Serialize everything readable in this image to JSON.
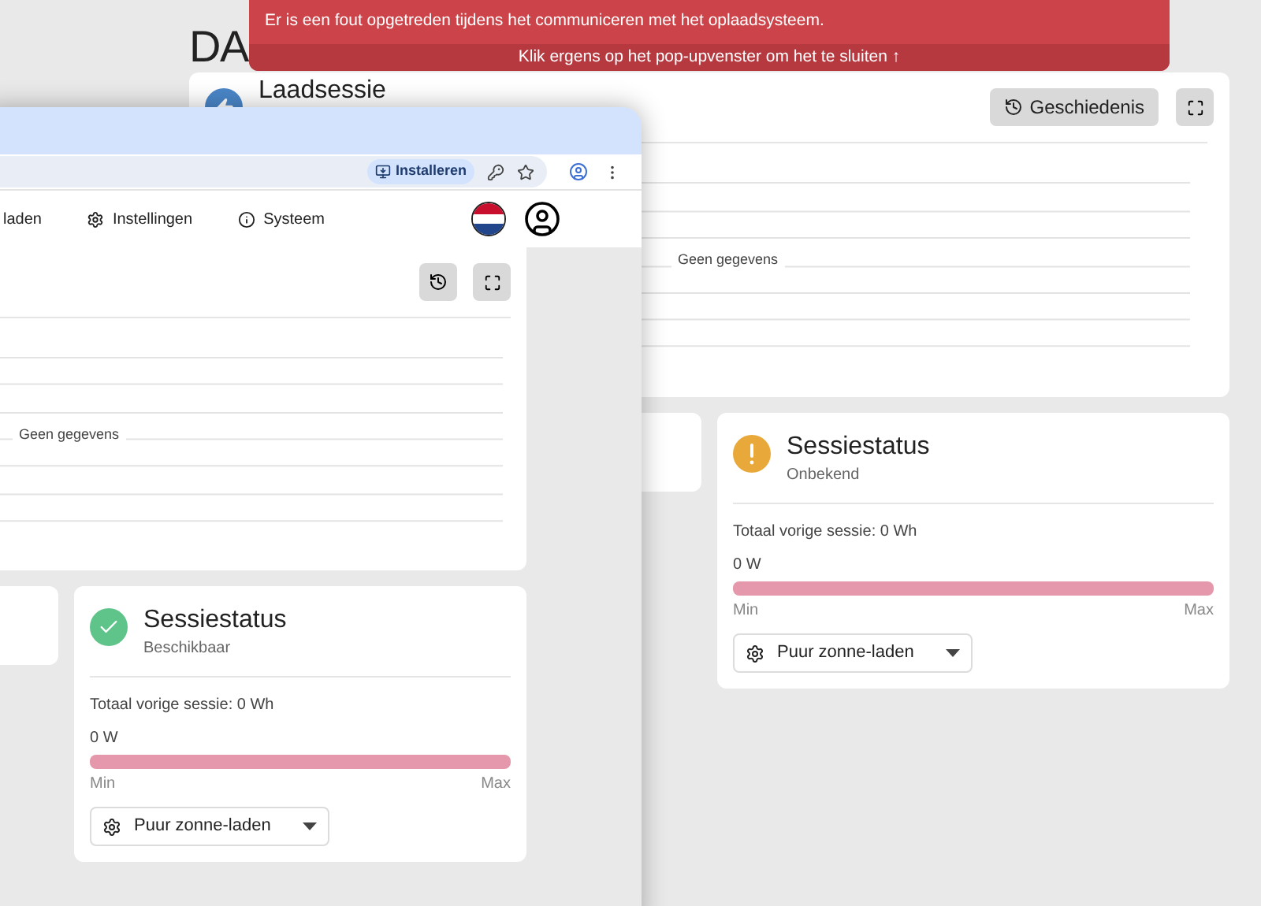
{
  "background_app": {
    "heading": "DA",
    "session_card": {
      "title": "Laadsessie",
      "history_button": "Geschiedenis",
      "chart_message": "Geen gegevens"
    },
    "status_card": {
      "kind": "warning",
      "title": "Sessiestatus",
      "status": "Onbekend",
      "total": "Totaal vorige sessie: 0 Wh",
      "power": "0 W",
      "min": "Min",
      "max": "Max",
      "mode": "Puur zonne-laden"
    }
  },
  "error_toast": {
    "message": "Er is een fout opgetreden tijdens het communiceren met het oplaadsysteem.",
    "dismiss_hint": "Klik ergens op het pop-upvenster om het te sluiten ↑"
  },
  "browser": {
    "install_button": "Installeren",
    "nav_tabs": [
      {
        "label": "laden",
        "kind": "plain"
      },
      {
        "label": "Instellingen",
        "kind": "settings"
      },
      {
        "label": "Systeem",
        "kind": "info"
      }
    ],
    "session_card": {
      "chart_message": "Geen gegevens"
    },
    "status_card": {
      "kind": "ok",
      "title": "Sessiestatus",
      "status": "Beschikbaar",
      "total": "Totaal vorige sessie: 0 Wh",
      "power": "0 W",
      "min": "Min",
      "max": "Max",
      "mode": "Puur zonne-laden"
    }
  }
}
